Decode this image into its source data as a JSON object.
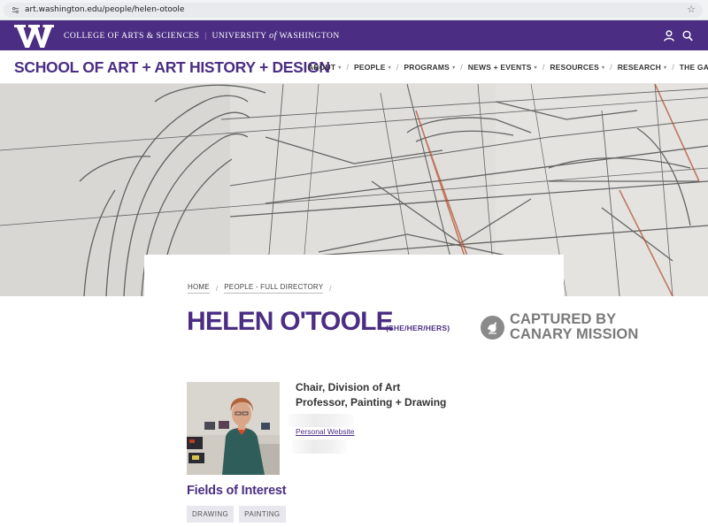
{
  "browser": {
    "url": "art.washington.edu/people/helen-otoole",
    "icons": {
      "site": "site-info-icon",
      "bookmark": "star-icon"
    }
  },
  "topbar": {
    "college": "COLLEGE OF ARTS & SCIENCES",
    "separator": "|",
    "university_pre": "UNIVERSITY",
    "university_of": "of",
    "university_post": "WASHINGTON",
    "icons": {
      "logo": "uw-w-logo",
      "account": "user-icon",
      "search": "search-icon"
    },
    "color": "#4b2e83"
  },
  "header": {
    "school": "SCHOOL OF ART + ART HISTORY + DESIGN",
    "nav": [
      {
        "label": "ABOUT",
        "caret": "▾"
      },
      {
        "label": "PEOPLE",
        "caret": "▾"
      },
      {
        "label": "PROGRAMS",
        "caret": "▾"
      },
      {
        "label": "NEWS + EVENTS",
        "caret": "▾"
      },
      {
        "label": "RESOURCES",
        "caret": "▾"
      },
      {
        "label": "RESEARCH",
        "caret": "▾"
      },
      {
        "label": "THE GALLERY",
        "caret": "▾"
      }
    ],
    "nav_separator": "/"
  },
  "breadcrumb": {
    "items": [
      "HOME",
      "PEOPLE - FULL DIRECTORY"
    ],
    "separator": "/"
  },
  "profile": {
    "name": "HELEN O'TOOLE",
    "pronouns": "(SHE/HER/HERS)",
    "titles": [
      "Chair, Division of Art",
      "Professor, Painting + Drawing"
    ],
    "website_label": "Personal Website",
    "fields_heading": "Fields of Interest",
    "fields": [
      "DRAWING",
      "PAINTING"
    ]
  },
  "badge": {
    "line1": "CAPTURED BY",
    "line2": "CANARY MISSION",
    "icon": "canary-bird-icon"
  }
}
